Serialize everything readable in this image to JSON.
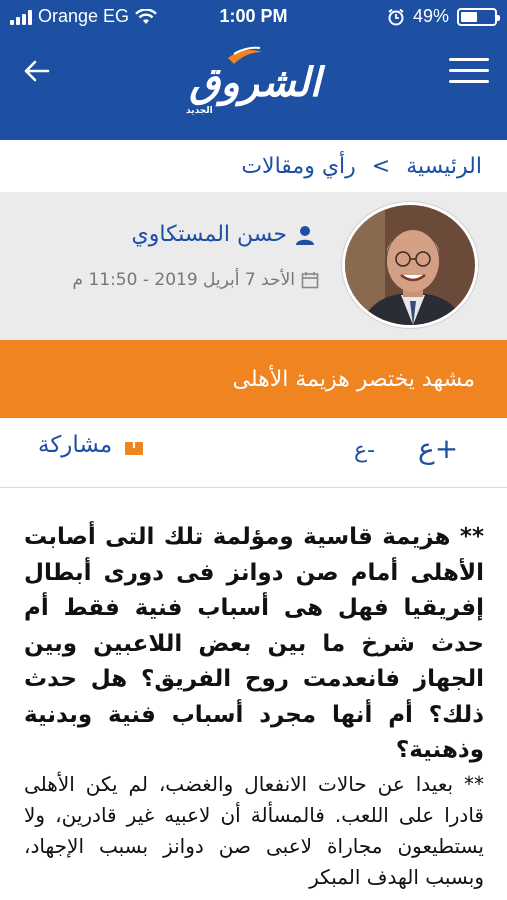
{
  "status_bar": {
    "carrier": "Orange EG",
    "time": "1:00 PM",
    "battery_percent": "49%",
    "battery_level": 0.49
  },
  "header": {
    "logo_text": "الشروق",
    "logo_sub": "الجديد",
    "back_icon": "arrow-left-icon",
    "menu_icon": "hamburger-menu-icon",
    "background_color": "#1d4fa3"
  },
  "breadcrumb": {
    "home": "الرئيسية",
    "separator": ">",
    "section": "رأي ومقالات"
  },
  "author": {
    "name": "حسن المستكاوي",
    "date": "الأحد 7 أبريل 2019 - 11:50 م",
    "user_icon": "user-icon",
    "calendar_icon": "calendar-icon"
  },
  "article": {
    "title": "مشهد يختصر هزيمة الأهلى",
    "title_bar_color": "#f08421",
    "lead": "** هزيمة قاسية ومؤلمة تلك التى أصابت الأهلى أمام صن دوانز فى دورى أبطال إفريقيا فهل هى أسباب فنية فقط أم حدث شرخ ما بين بعض اللاعبين وبين الجهاز فانعدمت روح الفريق؟ هل حدث ذلك؟ أم أنها مجرد أسباب فنية وبدنية وذهنية؟",
    "body": "** بعيدا عن حالات الانفعال والغضب، لم يكن الأهلى قادرا على اللعب. فالمسألة أن لاعبيه غير قادرين، ولا يستطيعون مجاراة لاعبى صن دوانز بسبب الإجهاد، وبسبب الهدف المبكر"
  },
  "toolbar": {
    "font_increase": "ع+",
    "font_decrease": "ع-",
    "share_label": "مشاركة",
    "share_icon": "share-icon"
  }
}
